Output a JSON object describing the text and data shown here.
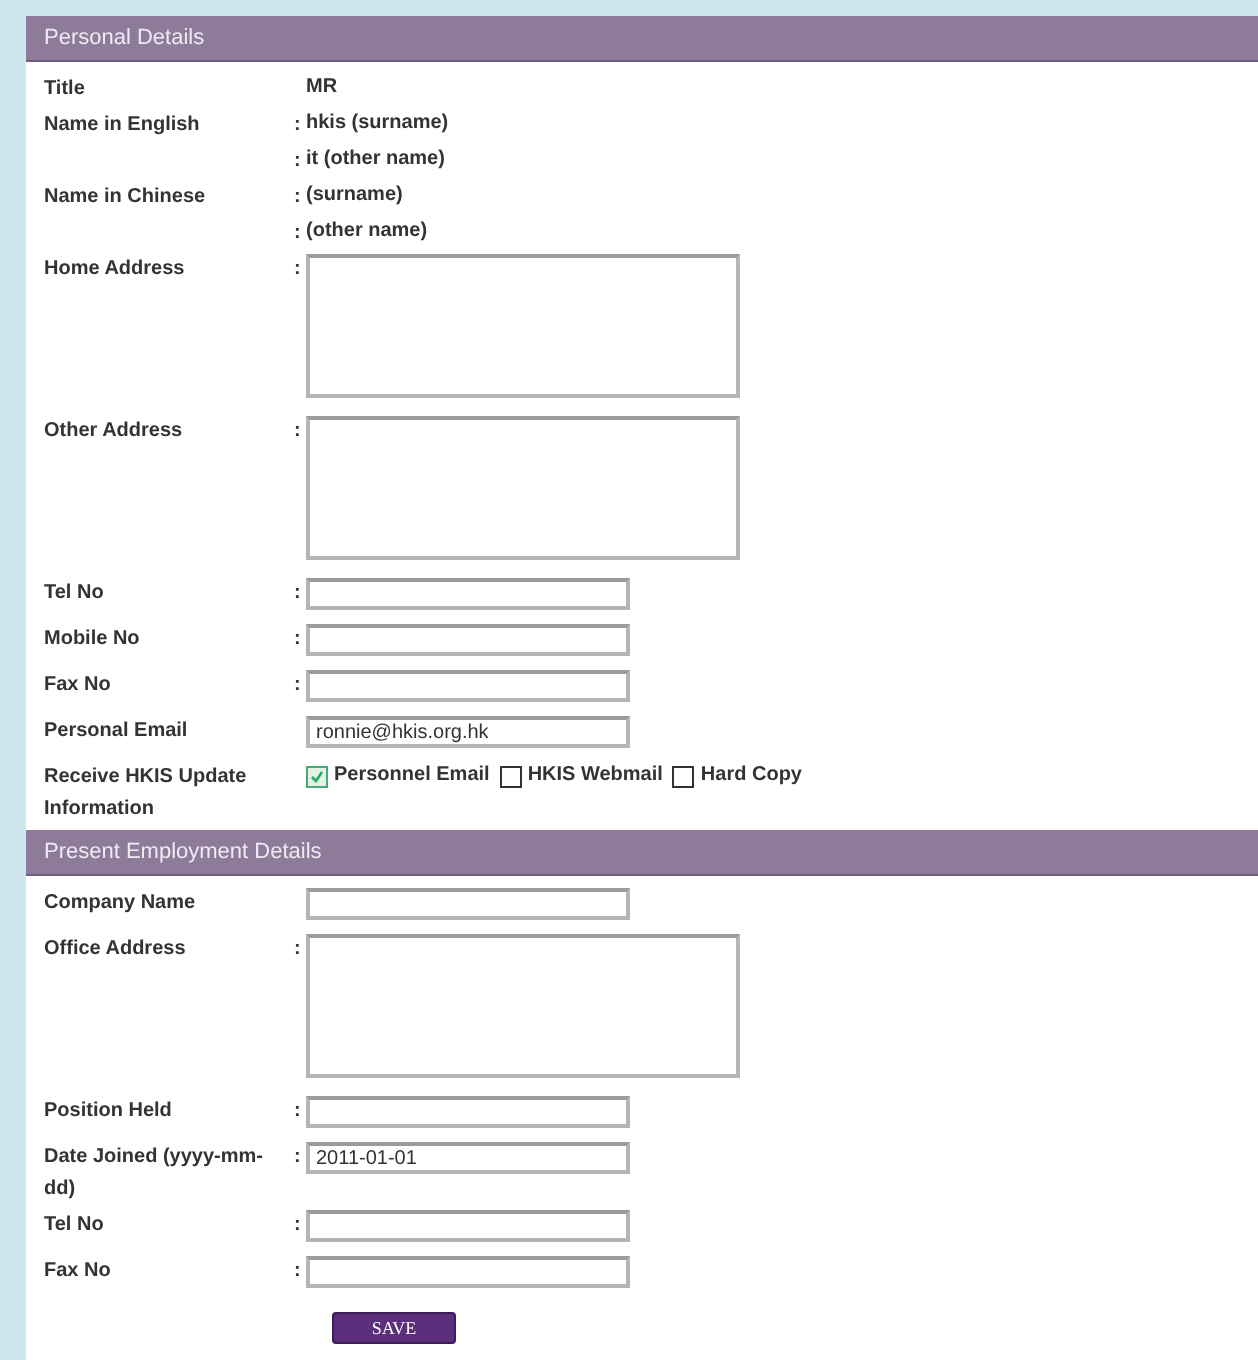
{
  "sections": [
    {
      "title": "Personal Details",
      "rows": [
        {
          "kind": "text",
          "label": "Title",
          "separator": "",
          "value": "MR"
        },
        {
          "kind": "text",
          "label": "Name in English",
          "separator": ":",
          "value": "hkis (surname)"
        },
        {
          "kind": "text",
          "label": "",
          "separator": ":",
          "value": "it (other name)"
        },
        {
          "kind": "text",
          "label": "Name in Chinese",
          "separator": ":",
          "value": "(surname)"
        },
        {
          "kind": "text",
          "label": "",
          "separator": ":",
          "value": "(other name)"
        },
        {
          "kind": "textarea",
          "label": "Home Address",
          "separator": ":",
          "value": ""
        },
        {
          "kind": "textarea",
          "label": "Other Address",
          "separator": ":",
          "value": ""
        },
        {
          "kind": "input",
          "label": "Tel No",
          "separator": ":",
          "value": ""
        },
        {
          "kind": "input",
          "label": "Mobile No",
          "separator": ":",
          "value": ""
        },
        {
          "kind": "input",
          "label": "Fax No",
          "separator": ":",
          "value": ""
        },
        {
          "kind": "input",
          "label": "Personal Email",
          "separator": "",
          "value": "ronnie@hkis.org.hk"
        },
        {
          "kind": "checkboxes",
          "label": "Receive HKIS Update Information",
          "separator": "",
          "options": [
            {
              "label": "Personnel Email",
              "checked": true
            },
            {
              "label": "HKIS Webmail",
              "checked": false
            },
            {
              "label": "Hard Copy",
              "checked": false
            }
          ]
        }
      ]
    },
    {
      "title": "Present Employment Details",
      "rows": [
        {
          "kind": "input",
          "label": "Company Name",
          "separator": "",
          "value": ""
        },
        {
          "kind": "textarea",
          "label": "Office Address",
          "separator": ":",
          "value": ""
        },
        {
          "kind": "input",
          "label": "Position Held",
          "separator": ":",
          "value": ""
        },
        {
          "kind": "input",
          "label": "Date Joined (yyyy-mm-dd)",
          "separator": ":",
          "value": "2011-01-01"
        },
        {
          "kind": "input",
          "label": "Tel No",
          "separator": ":",
          "value": ""
        },
        {
          "kind": "input",
          "label": "Fax No",
          "separator": ":",
          "value": ""
        }
      ]
    }
  ],
  "save_button": "SAVE"
}
